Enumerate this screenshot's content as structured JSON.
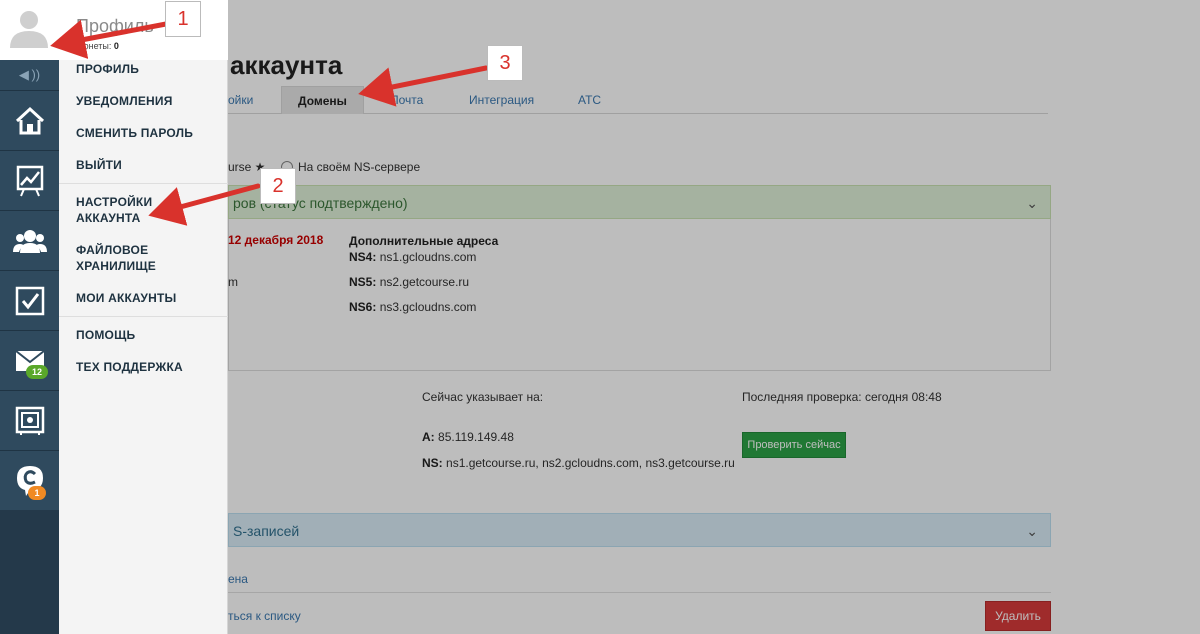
{
  "page": {
    "title": "аккаунта",
    "tabs": [
      {
        "label": "ойки"
      },
      {
        "label": "Домены"
      },
      {
        "label": "Почта"
      },
      {
        "label": "Интеграция"
      },
      {
        "label": "АТС"
      }
    ],
    "radio_left_label": "urse ★",
    "radio_right_label": "На своём NS-сервере",
    "green_panel_title": "ров (статус подтверждено)",
    "date_text": "12 декабря 2018",
    "partial_text_m": "m",
    "extra_addresses_title": "Дополнительные адреса",
    "ns_rows": [
      {
        "label": "NS4:",
        "value": "ns1.gcloudns.com"
      },
      {
        "label": "NS5:",
        "value": "ns2.getcourse.ru"
      },
      {
        "label": "NS6:",
        "value": "ns3.gcloudns.com"
      }
    ],
    "points_to_label": "Сейчас указывает на:",
    "a_label": "A:",
    "a_value": "85.119.149.48",
    "ns_label": "NS:",
    "ns_value": "ns1.getcourse.ru, ns2.gcloudns.com, ns3.getcourse.ru",
    "last_check": "Последняя проверка: сегодня 08:48",
    "check_now_button": "Проверить сейчас",
    "blue_panel_title": "S-записей",
    "link_partial": "ена",
    "back_link": "ться к списку",
    "delete_button": "Удалить"
  },
  "sidebar": {
    "mail_badge": "12",
    "chat_badge": "1"
  },
  "dropdown": {
    "profile_name": "Профиль",
    "coins_label": "Монеты:",
    "coins_value": "0",
    "items": [
      {
        "label": "ПРОФИЛЬ"
      },
      {
        "label": "УВЕДОМЛЕНИЯ"
      },
      {
        "label": "СМЕНИТЬ ПАРОЛЬ"
      },
      {
        "label": "ВЫЙТИ"
      },
      {
        "label": "НАСТРОЙКИ АККАУНТА"
      },
      {
        "label": "ФАЙЛОВОЕ ХРАНИЛИЩЕ"
      },
      {
        "label": "МОИ АККАУНТЫ"
      },
      {
        "label": "ПОМОЩЬ"
      },
      {
        "label": "ТЕХ ПОДДЕРЖКА"
      }
    ]
  },
  "annotations": {
    "n1": "1",
    "n2": "2",
    "n3": "3",
    "color": "#d9322c"
  }
}
